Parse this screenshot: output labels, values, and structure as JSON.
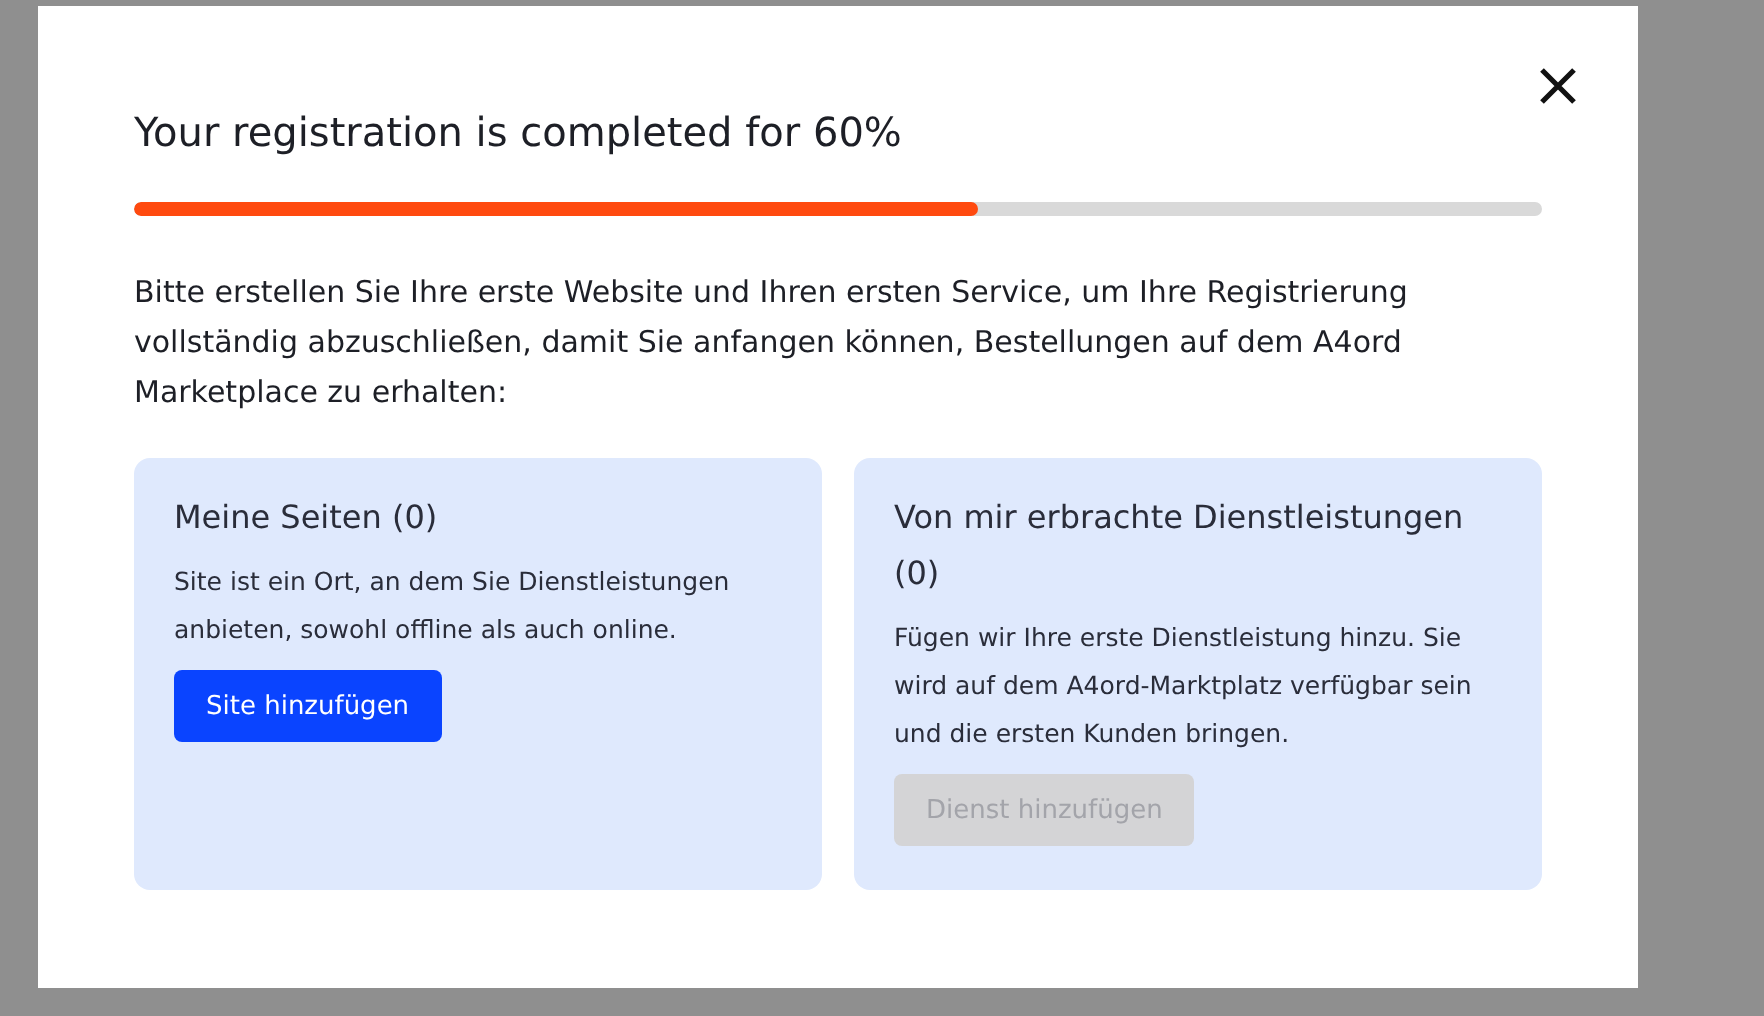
{
  "modal": {
    "title": "Your registration is completed for 60%",
    "progress": {
      "level": 0.6
    },
    "intro": "Bitte erstellen Sie Ihre erste Website und Ihren ersten Service, um Ihre Registrierung vollständig abzuschließen, damit Sie anfangen können, Bestellungen auf dem A4ord Marketplace zu erhalten:",
    "cards": [
      {
        "title": "Meine Seiten (0)",
        "text": "Site ist ein Ort, an dem Sie Dienstleistungen anbieten, sowohl offline als auch online.",
        "button": {
          "label": "Site hinzufügen",
          "disabled": false
        }
      },
      {
        "title": "Von mir erbrachte Dienstleistungen (0)",
        "text": "Fügen wir Ihre erste Dienstleistung hinzu. Sie wird auf dem A4ord-Marktplatz verfügbar sein und die ersten Kunden bringen.",
        "button": {
          "label": "Dienst hinzufügen",
          "disabled": true
        }
      }
    ]
  }
}
